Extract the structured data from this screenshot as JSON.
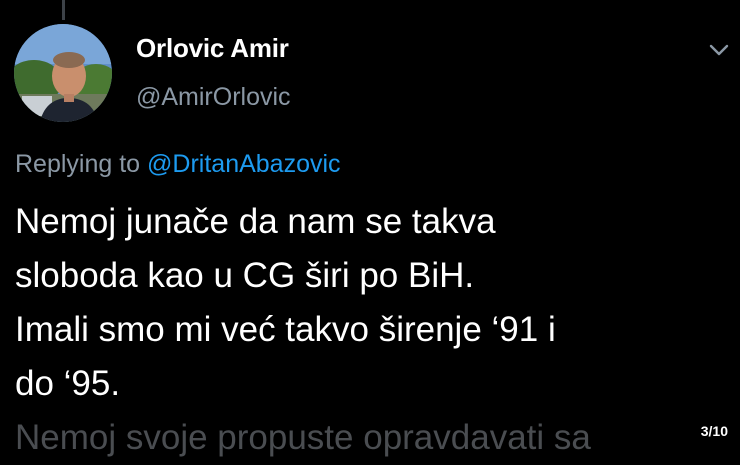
{
  "author": {
    "display_name": "Orlovic Amir",
    "handle": "@AmirOrlovic",
    "avatar_icon": "profile-photo"
  },
  "reply_context": {
    "prefix": "Replying to",
    "mention": "@DritanAbazovic"
  },
  "tweet": {
    "lines": [
      "Nemoj junače da nam se takva",
      "sloboda kao u CG širi po BiH.",
      "Imali smo mi već takvo širenje ‘91 i",
      "do ‘95.",
      "Nemoj svoje propuste opravdavati sa"
    ]
  },
  "overlay": {
    "page_counter": "3/10"
  },
  "icons": {
    "more": "chevron-down-icon"
  },
  "colors": {
    "background": "#000000",
    "primary_text": "#ffffff",
    "secondary_text": "#8b98a5",
    "accent": "#1d9bf0"
  }
}
